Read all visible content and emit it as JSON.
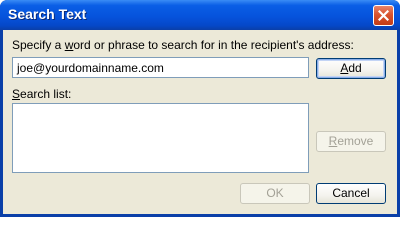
{
  "window": {
    "title": "Search Text"
  },
  "form": {
    "instruction_pre": "Specify a ",
    "instruction_accel": "w",
    "instruction_post": "ord or phrase to search for in the recipient's address:",
    "input_value": "joe@yourdomainname.com",
    "list_label_accel": "S",
    "list_label_rest": "earch list:",
    "search_list_items": []
  },
  "buttons": {
    "add_accel": "A",
    "add_rest": "dd",
    "remove_accel": "R",
    "remove_rest": "emove",
    "ok_label": "OK",
    "cancel_label": "Cancel"
  },
  "icons": {
    "close": "close-icon"
  },
  "colors": {
    "titlebar": "#0653dc",
    "client_background": "#ece9d8",
    "close_button": "#d9532e",
    "button_border": "#003c74",
    "disabled_text": "#a3a196"
  }
}
